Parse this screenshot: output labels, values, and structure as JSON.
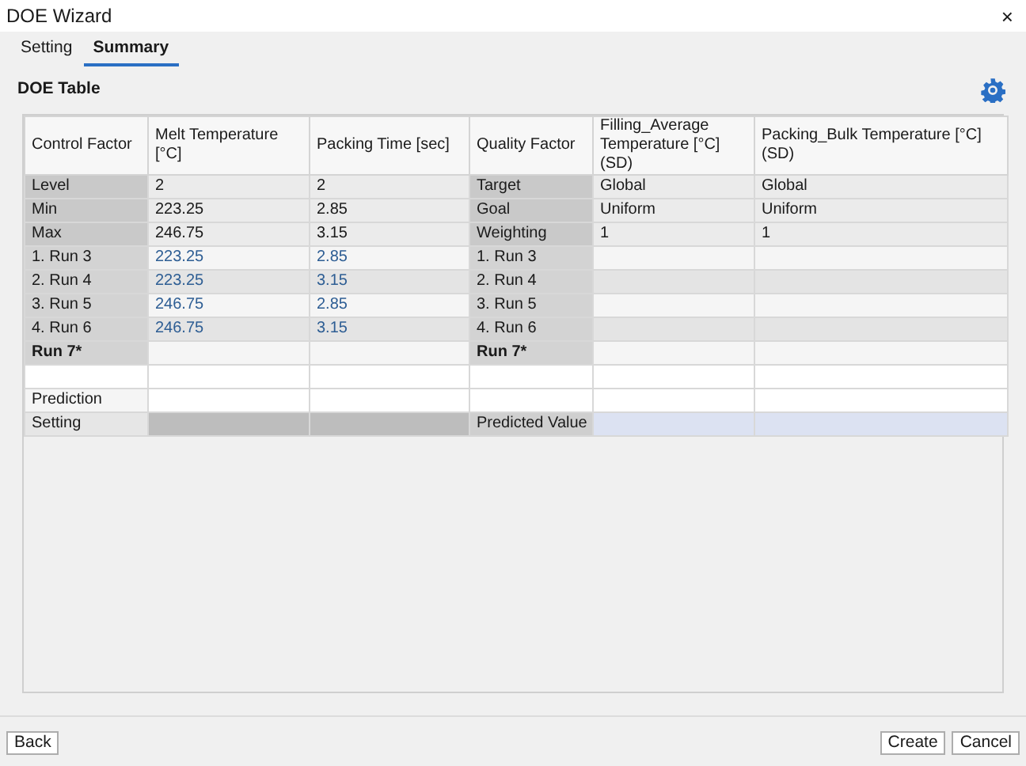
{
  "window": {
    "title": "DOE Wizard",
    "close": "×"
  },
  "tabs": [
    {
      "label": "Setting",
      "selected": false
    },
    {
      "label": "Summary",
      "selected": true
    }
  ],
  "section_title": "DOE Table",
  "table": {
    "columns": [
      "Control Factor",
      "Melt Temperature [°C]",
      "Packing Time [sec]",
      "Quality Factor",
      "Filling_Average Temperature [°C] (SD)",
      "Packing_Bulk Temperature [°C] (SD)"
    ],
    "rows": [
      {
        "kind": "spec",
        "cells": [
          "Level",
          "2",
          "2",
          "Target",
          "Global",
          "Global"
        ]
      },
      {
        "kind": "spec",
        "cells": [
          "Min",
          "223.25",
          "2.85",
          "Goal",
          "Uniform",
          "Uniform"
        ]
      },
      {
        "kind": "spec",
        "cells": [
          "Max",
          "246.75",
          "3.15",
          "Weighting",
          "1",
          "1"
        ]
      },
      {
        "kind": "run",
        "cells": [
          "1. Run 3",
          "223.25",
          "2.85",
          "1. Run 3",
          null,
          null
        ]
      },
      {
        "kind": "run",
        "cells": [
          "2. Run 4",
          "223.25",
          "3.15",
          "2. Run 4",
          null,
          null
        ]
      },
      {
        "kind": "run",
        "cells": [
          "3. Run 5",
          "246.75",
          "2.85",
          "3. Run 5",
          null,
          null
        ]
      },
      {
        "kind": "run",
        "cells": [
          "4. Run 6",
          "246.75",
          "3.15",
          "4. Run 6",
          null,
          null
        ]
      },
      {
        "kind": "new_run",
        "cells": [
          "Run 7*",
          null,
          null,
          "Run 7*",
          null,
          null
        ]
      },
      {
        "kind": "blank",
        "cells": [
          null,
          null,
          null,
          null,
          null,
          null
        ]
      },
      {
        "kind": "prediction",
        "cells": [
          "Prediction",
          null,
          null,
          null,
          null,
          null
        ]
      },
      {
        "kind": "setting",
        "cells": [
          "Setting",
          null,
          null,
          "Predicted Value",
          null,
          null
        ]
      }
    ]
  },
  "buttons": {
    "back": "Back",
    "create": "Create",
    "cancel": "Cancel"
  }
}
